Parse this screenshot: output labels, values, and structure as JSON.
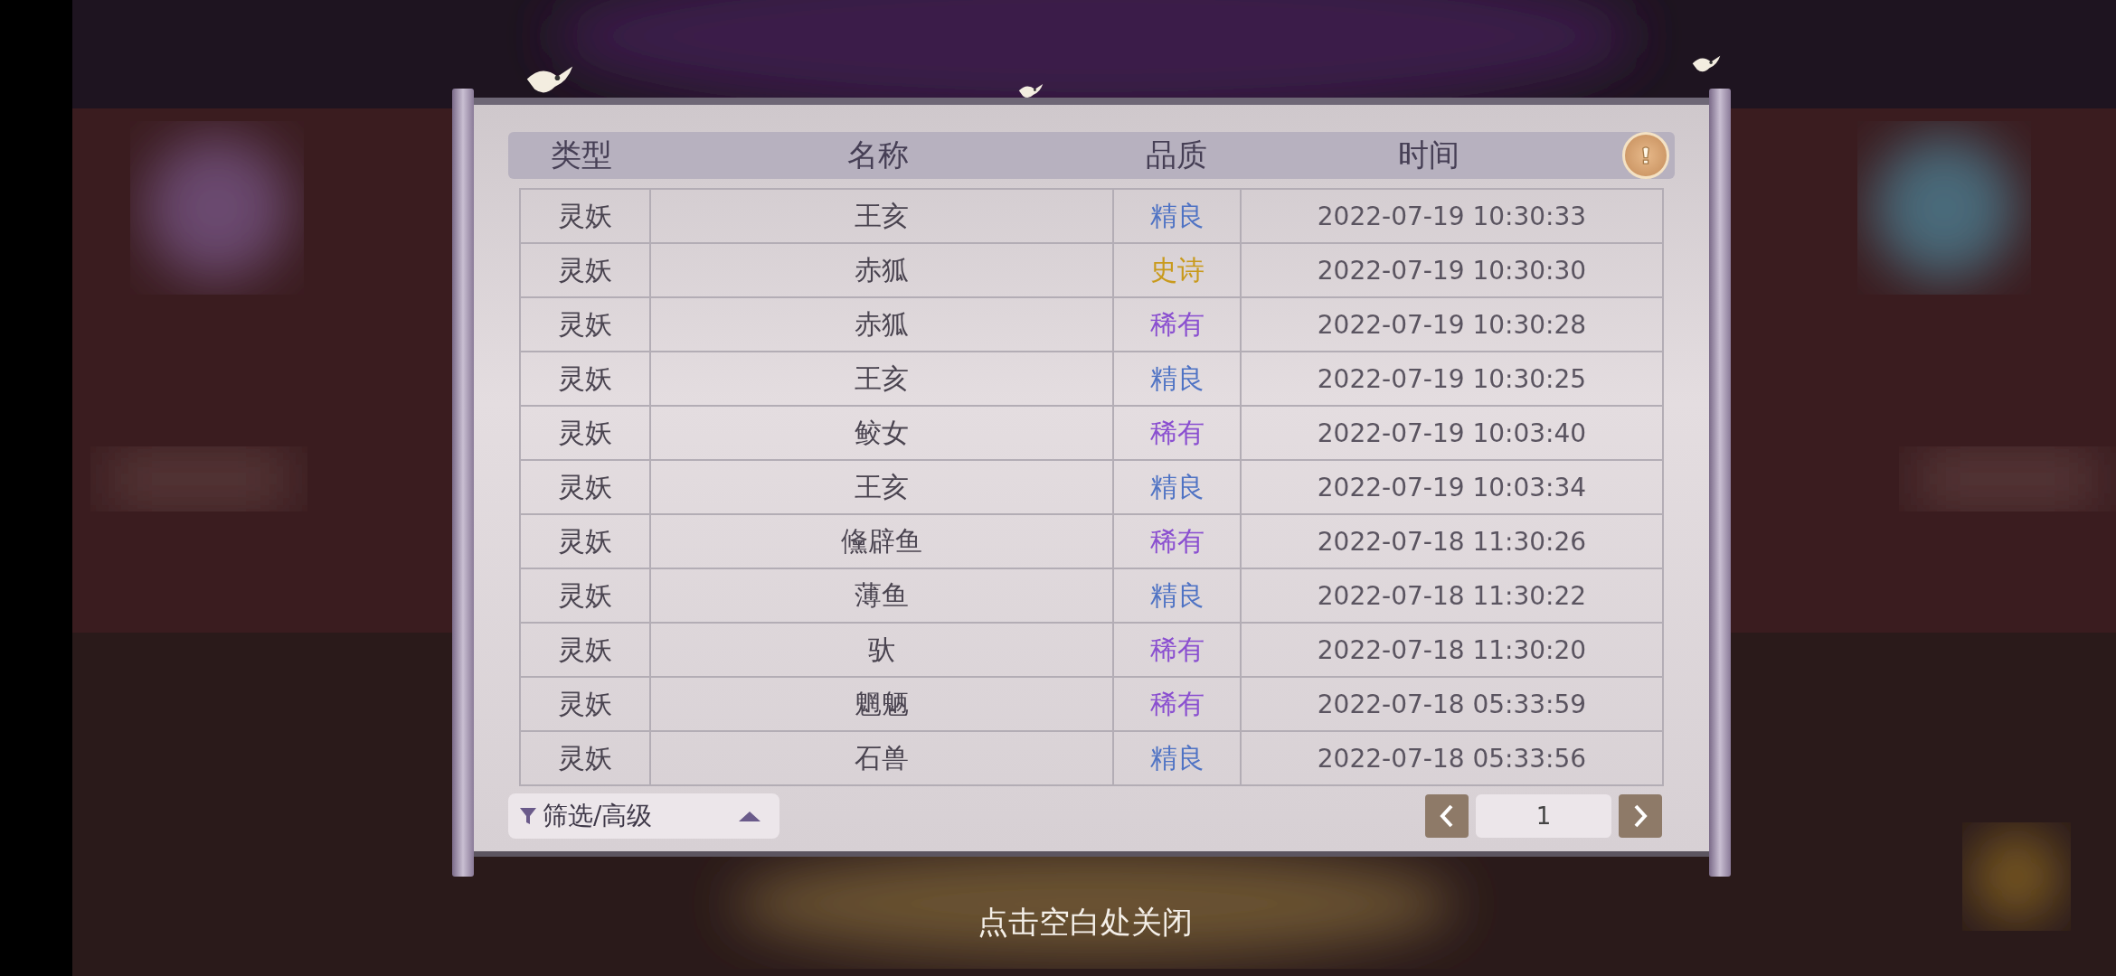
{
  "table": {
    "columns": [
      "类型",
      "名称",
      "品质",
      "时间"
    ],
    "rows": [
      {
        "type": "灵妖",
        "name": "王亥",
        "quality": "精良",
        "color": "#4f73c4",
        "time": "2022-07-19  10:30:33"
      },
      {
        "type": "灵妖",
        "name": "赤狐",
        "quality": "史诗",
        "color": "#c99a1c",
        "time": "2022-07-19  10:30:30"
      },
      {
        "type": "灵妖",
        "name": "赤狐",
        "quality": "稀有",
        "color": "#8a4fd0",
        "time": "2022-07-19  10:30:28"
      },
      {
        "type": "灵妖",
        "name": "王亥",
        "quality": "精良",
        "color": "#4f73c4",
        "time": "2022-07-19  10:30:25"
      },
      {
        "type": "灵妖",
        "name": "鲛女",
        "quality": "稀有",
        "color": "#8a4fd0",
        "time": "2022-07-19  10:03:40"
      },
      {
        "type": "灵妖",
        "name": "王亥",
        "quality": "精良",
        "color": "#4f73c4",
        "time": "2022-07-19  10:03:34"
      },
      {
        "type": "灵妖",
        "name": "儵辟鱼",
        "quality": "稀有",
        "color": "#8a4fd0",
        "time": "2022-07-18  11:30:26"
      },
      {
        "type": "灵妖",
        "name": "薄鱼",
        "quality": "精良",
        "color": "#4f73c4",
        "time": "2022-07-18  11:30:22"
      },
      {
        "type": "灵妖",
        "name": "驮",
        "quality": "稀有",
        "color": "#8a4fd0",
        "time": "2022-07-18  11:30:20"
      },
      {
        "type": "灵妖",
        "name": "魍魉",
        "quality": "稀有",
        "color": "#8a4fd0",
        "time": "2022-07-18  05:33:59"
      },
      {
        "type": "灵妖",
        "name": "石兽",
        "quality": "精良",
        "color": "#4f73c4",
        "time": "2022-07-18  05:33:56"
      }
    ]
  },
  "filter": {
    "label": "筛选/高级"
  },
  "pagination": {
    "page": "1"
  },
  "close_hint": "点击空白处关闭"
}
